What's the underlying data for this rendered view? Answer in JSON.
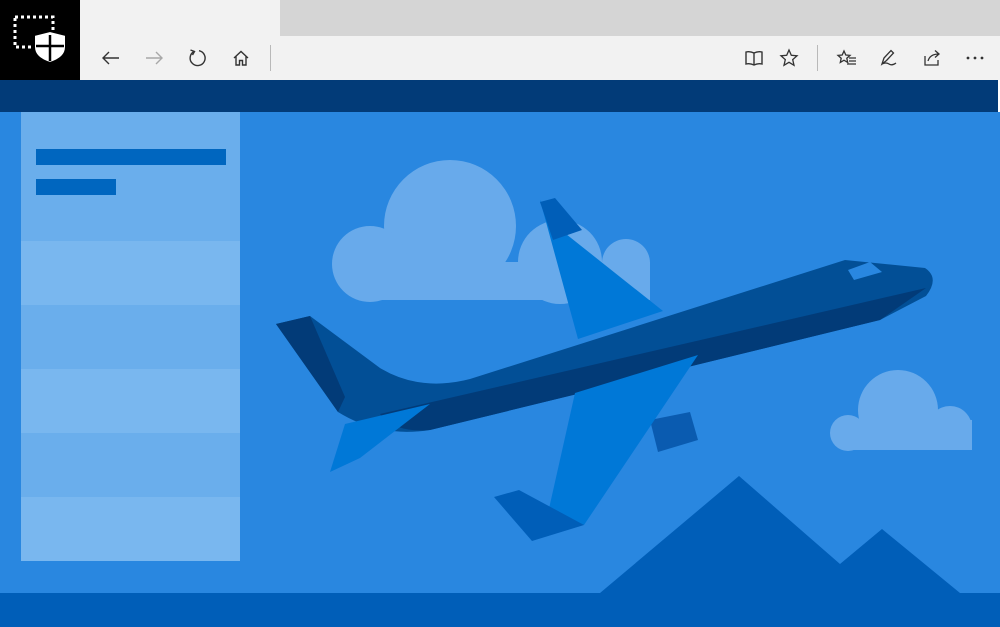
{
  "window": {
    "badge_icon": "window-guard-shield-icon",
    "active_tab_title": ""
  },
  "toolbar": {
    "buttons": [
      {
        "name": "back-button",
        "icon": "arrow-left-icon",
        "enabled": true
      },
      {
        "name": "forward-button",
        "icon": "arrow-right-icon",
        "enabled": false
      },
      {
        "name": "refresh-button",
        "icon": "refresh-icon",
        "enabled": true
      },
      {
        "name": "home-button",
        "icon": "home-icon",
        "enabled": true
      },
      {
        "name": "reading-view-button",
        "icon": "book-icon",
        "enabled": true
      },
      {
        "name": "favorite-button",
        "icon": "star-icon",
        "enabled": true
      },
      {
        "name": "favorites-hub-button",
        "icon": "star-list-icon",
        "enabled": true
      },
      {
        "name": "web-note-button",
        "icon": "pen-icon",
        "enabled": true
      },
      {
        "name": "share-button",
        "icon": "share-icon",
        "enabled": true
      },
      {
        "name": "more-button",
        "icon": "ellipsis-icon",
        "enabled": true
      }
    ]
  },
  "page": {
    "illustration": "airplane-clouds-mountains",
    "colors": {
      "header": "#023b78",
      "background": "#2987e0",
      "panel": "#6aaeec",
      "panel_light": "#79b7ef",
      "skeleton": "#0066bf",
      "footer": "#005eb8",
      "cloud": "#68aaeb",
      "mountain": "#005eb8"
    }
  }
}
